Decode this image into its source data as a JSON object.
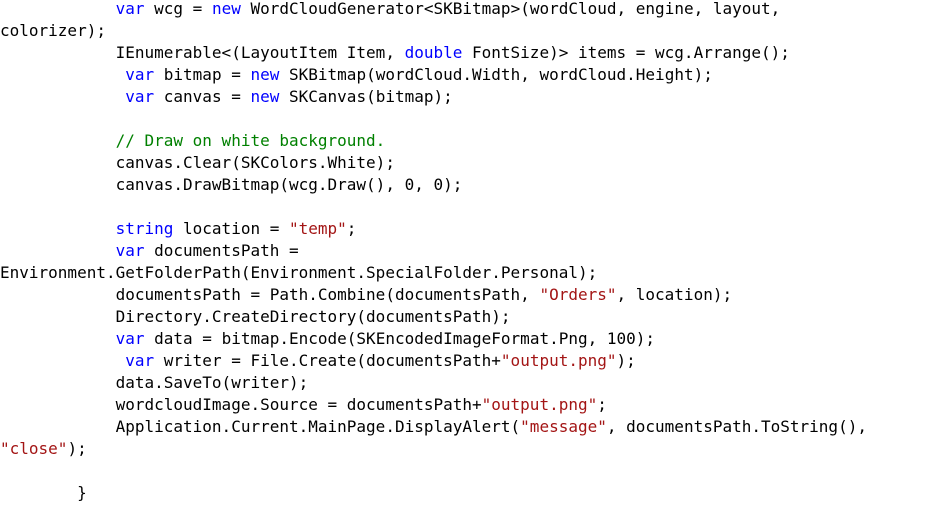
{
  "editor": {
    "lines": [
      {
        "indent": "            ",
        "tokens": [
          {
            "t": "var",
            "c": "kw"
          },
          {
            "t": " wcg = ",
            "c": "pl"
          },
          {
            "t": "new",
            "c": "kw"
          },
          {
            "t": " WordCloudGenerator<SKBitmap>(wordCloud, engine, layout,",
            "c": "pl"
          }
        ]
      },
      {
        "indent": "",
        "tokens": [
          {
            "t": "colorizer);",
            "c": "pl"
          }
        ]
      },
      {
        "indent": "            ",
        "tokens": [
          {
            "t": "IEnumerable<(LayoutItem Item, ",
            "c": "pl"
          },
          {
            "t": "double",
            "c": "kw"
          },
          {
            "t": " FontSize)> items = wcg.Arrange();",
            "c": "pl"
          }
        ]
      },
      {
        "indent": "             ",
        "tokens": [
          {
            "t": "var",
            "c": "kw"
          },
          {
            "t": " bitmap = ",
            "c": "pl"
          },
          {
            "t": "new",
            "c": "kw"
          },
          {
            "t": " SKBitmap(wordCloud.Width, wordCloud.Height);",
            "c": "pl"
          }
        ]
      },
      {
        "indent": "             ",
        "tokens": [
          {
            "t": "var",
            "c": "kw"
          },
          {
            "t": " canvas = ",
            "c": "pl"
          },
          {
            "t": "new",
            "c": "kw"
          },
          {
            "t": " SKCanvas(bitmap);",
            "c": "pl"
          }
        ]
      },
      {
        "indent": "",
        "tokens": []
      },
      {
        "indent": "            ",
        "tokens": [
          {
            "t": "// Draw on white background.",
            "c": "cm"
          }
        ]
      },
      {
        "indent": "            ",
        "tokens": [
          {
            "t": "canvas.Clear(SKColors.White);",
            "c": "pl"
          }
        ]
      },
      {
        "indent": "            ",
        "tokens": [
          {
            "t": "canvas.DrawBitmap(wcg.Draw(), 0, 0);",
            "c": "pl"
          }
        ]
      },
      {
        "indent": "",
        "tokens": []
      },
      {
        "indent": "            ",
        "tokens": [
          {
            "t": "string",
            "c": "kw"
          },
          {
            "t": " location = ",
            "c": "pl"
          },
          {
            "t": "\"temp\"",
            "c": "str"
          },
          {
            "t": ";",
            "c": "pl"
          }
        ]
      },
      {
        "indent": "            ",
        "tokens": [
          {
            "t": "var",
            "c": "kw"
          },
          {
            "t": " documentsPath =",
            "c": "pl"
          }
        ]
      },
      {
        "indent": "",
        "tokens": [
          {
            "t": "Environment.GetFolderPath(Environment.SpecialFolder.Personal);",
            "c": "pl"
          }
        ]
      },
      {
        "indent": "            ",
        "tokens": [
          {
            "t": "documentsPath = Path.Combine(documentsPath, ",
            "c": "pl"
          },
          {
            "t": "\"Orders\"",
            "c": "str"
          },
          {
            "t": ", location);",
            "c": "pl"
          }
        ]
      },
      {
        "indent": "            ",
        "tokens": [
          {
            "t": "Directory.CreateDirectory(documentsPath);",
            "c": "pl"
          }
        ]
      },
      {
        "indent": "            ",
        "tokens": [
          {
            "t": "var",
            "c": "kw"
          },
          {
            "t": " data = bitmap.Encode(SKEncodedImageFormat.Png, 100);",
            "c": "pl"
          }
        ]
      },
      {
        "indent": "             ",
        "tokens": [
          {
            "t": "var",
            "c": "kw"
          },
          {
            "t": " writer = File.Create(documentsPath+",
            "c": "pl"
          },
          {
            "t": "\"output.png\"",
            "c": "str"
          },
          {
            "t": ");",
            "c": "pl"
          }
        ]
      },
      {
        "indent": "            ",
        "tokens": [
          {
            "t": "data.SaveTo(writer);",
            "c": "pl"
          }
        ]
      },
      {
        "indent": "            ",
        "tokens": [
          {
            "t": "wordcloudImage.Source = documentsPath+",
            "c": "pl"
          },
          {
            "t": "\"output.png\"",
            "c": "str"
          },
          {
            "t": ";",
            "c": "pl"
          }
        ]
      },
      {
        "indent": "            ",
        "tokens": [
          {
            "t": "Application.Current.MainPage.DisplayAlert(",
            "c": "pl"
          },
          {
            "t": "\"message\"",
            "c": "str"
          },
          {
            "t": ", documentsPath.ToString(),",
            "c": "pl"
          }
        ]
      },
      {
        "indent": "",
        "tokens": [
          {
            "t": "\"close\"",
            "c": "str"
          },
          {
            "t": ");",
            "c": "pl"
          }
        ]
      },
      {
        "indent": "",
        "tokens": []
      },
      {
        "indent": "        ",
        "tokens": [
          {
            "t": "}",
            "c": "pl"
          }
        ]
      }
    ]
  },
  "colors": {
    "keyword": "#0000ff",
    "string": "#a31515",
    "comment": "#008000",
    "plain": "#000000",
    "background": "#ffffff"
  }
}
